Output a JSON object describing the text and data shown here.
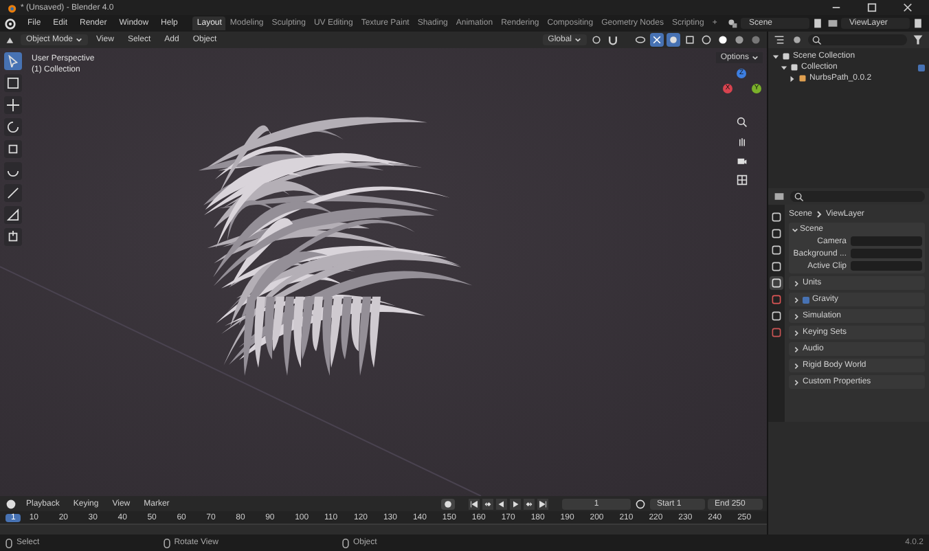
{
  "window": {
    "title": "* (Unsaved) - Blender 4.0"
  },
  "menu": [
    "File",
    "Edit",
    "Render",
    "Window",
    "Help"
  ],
  "workspaces": [
    {
      "label": "Layout",
      "selected": true
    },
    {
      "label": "Modeling",
      "selected": false
    },
    {
      "label": "Sculpting",
      "selected": false
    },
    {
      "label": "UV Editing",
      "selected": false
    },
    {
      "label": "Texture Paint",
      "selected": false
    },
    {
      "label": "Shading",
      "selected": false
    },
    {
      "label": "Animation",
      "selected": false
    },
    {
      "label": "Rendering",
      "selected": false
    },
    {
      "label": "Compositing",
      "selected": false
    },
    {
      "label": "Geometry Nodes",
      "selected": false
    },
    {
      "label": "Scripting",
      "selected": false
    }
  ],
  "add_workspace": "+",
  "scene": "Scene",
  "view_layer": "ViewLayer",
  "viewport": {
    "mode": "Object Mode",
    "menus": [
      "View",
      "Select",
      "Add",
      "Object"
    ],
    "orientation": "Global",
    "options": "Options",
    "overlay_text": [
      "User Perspective",
      "(1) Collection"
    ],
    "tools": [
      {
        "selected": true
      },
      {
        "selected": false
      },
      {
        "selected": false
      },
      {
        "selected": false
      },
      {
        "selected": false
      },
      {
        "selected": false
      },
      {
        "selected": false
      },
      {
        "selected": false
      },
      {
        "selected": false
      }
    ],
    "axis_gizmo": [
      {
        "label": "X",
        "color": "#d8434f"
      },
      {
        "label": "Y",
        "color": "#7bb12a"
      },
      {
        "label": "Z",
        "color": "#3d7ee0"
      }
    ]
  },
  "outliner": {
    "items": [
      {
        "label": "Scene Collection",
        "expanded": true,
        "children": [
          {
            "label": "Collection",
            "expanded": true,
            "checked": true,
            "children": [
              {
                "label": "NurbsPath_0.0.2",
                "expanded": false
              }
            ]
          }
        ]
      }
    ]
  },
  "properties": {
    "breadcrumb": [
      "Scene",
      "ViewLayer"
    ],
    "tabs": [
      {
        "selected": false
      },
      {
        "selected": false
      },
      {
        "selected": false
      },
      {
        "selected": false
      },
      {
        "selected": true
      },
      {
        "selected": false
      },
      {
        "selected": false
      },
      {
        "selected": false
      }
    ],
    "panel": {
      "title": "Scene",
      "expanded": true,
      "fields": [
        "Camera",
        "Background ...",
        "Active Clip"
      ]
    },
    "subpanels": [
      {
        "label": "Units",
        "kind": "plain"
      },
      {
        "label": "Gravity",
        "kind": "checkbox",
        "checked": true
      },
      {
        "label": "Simulation",
        "kind": "plain"
      },
      {
        "label": "Keying Sets",
        "kind": "plain"
      },
      {
        "label": "Audio",
        "kind": "plain"
      },
      {
        "label": "Rigid Body World",
        "kind": "plain"
      },
      {
        "label": "Custom Properties",
        "kind": "plain"
      }
    ]
  },
  "timeline": {
    "menus": [
      "Playback",
      "Keying",
      "View",
      "Marker"
    ],
    "current_frame": "1",
    "start_label": "Start",
    "start": "1",
    "end_label": "End",
    "end": "250",
    "playhead": "1",
    "ruler": [
      "10",
      "20",
      "30",
      "40",
      "50",
      "60",
      "70",
      "80",
      "90",
      "100",
      "110",
      "120",
      "130",
      "140",
      "150",
      "160",
      "170",
      "180",
      "190",
      "200",
      "210",
      "220",
      "230",
      "240",
      "250"
    ]
  },
  "status_bar": {
    "items": [
      "Select",
      "Rotate View",
      "Object"
    ],
    "version": "4.0.2"
  }
}
